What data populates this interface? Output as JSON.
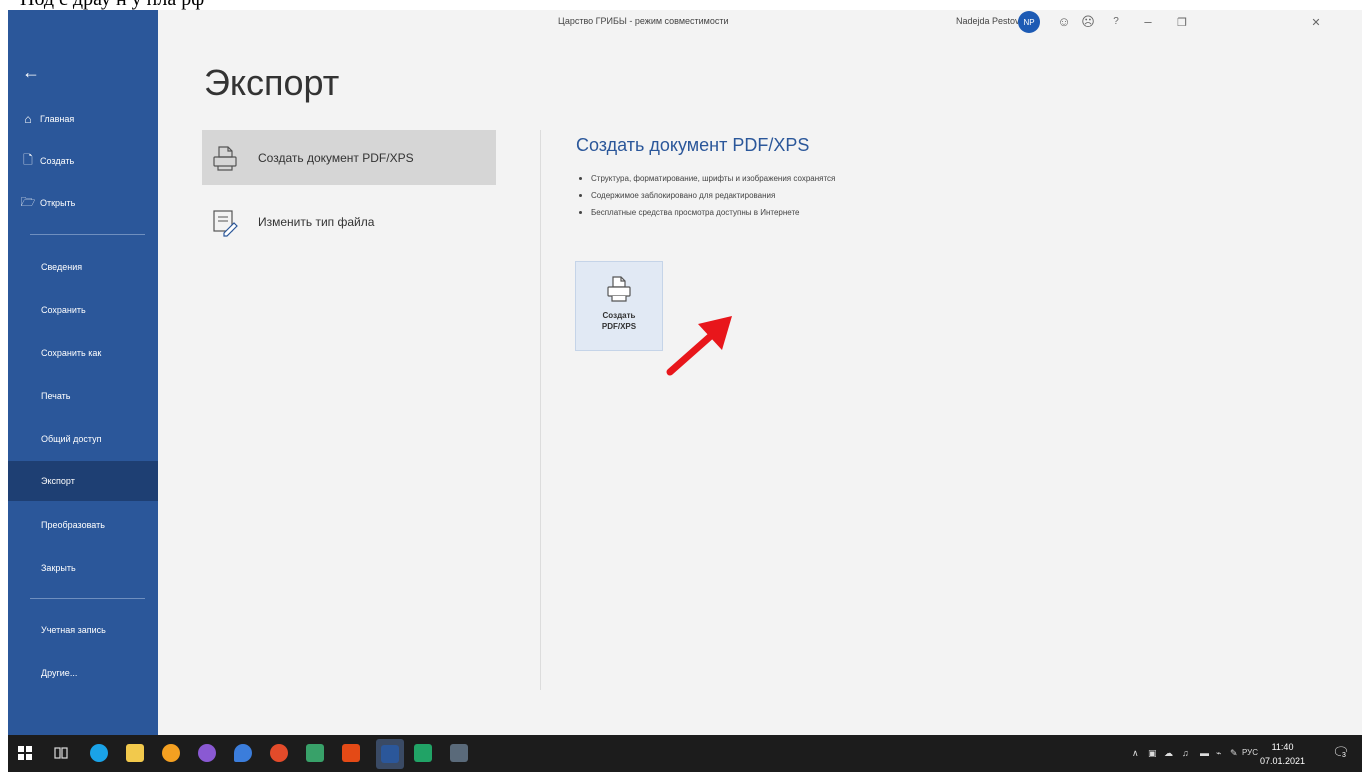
{
  "window": {
    "doc_title": "Царство ГРИБЫ  -  режим совместимости",
    "user_name": "Nadejda Pestova",
    "user_initials": "NP"
  },
  "sidebar": {
    "items": [
      {
        "label": "Главная",
        "icon": "home-icon"
      },
      {
        "label": "Создать",
        "icon": "new-document-icon"
      },
      {
        "label": "Открыть",
        "icon": "folder-open-icon"
      },
      {
        "label": "Сведения"
      },
      {
        "label": "Сохранить"
      },
      {
        "label": "Сохранить как"
      },
      {
        "label": "Печать"
      },
      {
        "label": "Общий доступ"
      },
      {
        "label": "Экспорт"
      },
      {
        "label": "Преобразовать"
      },
      {
        "label": "Закрыть"
      },
      {
        "label": "Учетная запись"
      },
      {
        "label": "Другие..."
      }
    ],
    "active": "Экспорт"
  },
  "page": {
    "heading": "Экспорт",
    "options": [
      {
        "label": "Создать документ PDF/XPS",
        "selected": true
      },
      {
        "label": "Изменить тип файла",
        "selected": false
      }
    ],
    "detail": {
      "title": "Создать документ PDF/XPS",
      "bullets": [
        "Структура, форматирование, шрифты и изображения сохранятся",
        "Содержимое заблокировано для редактирования",
        "Бесплатные средства просмотра доступны в Интернете"
      ],
      "button_line1": "Создать",
      "button_line2": "PDF/XPS"
    }
  },
  "taskbar": {
    "lang": "РУС",
    "time": "11:40",
    "date": "07.01.2021",
    "notification_count": "3"
  },
  "colors": {
    "sidebar": "#2b579a",
    "sidebar_active": "#1e3f73",
    "accent_title": "#2b579a",
    "annotation_arrow": "#e8161b"
  }
}
